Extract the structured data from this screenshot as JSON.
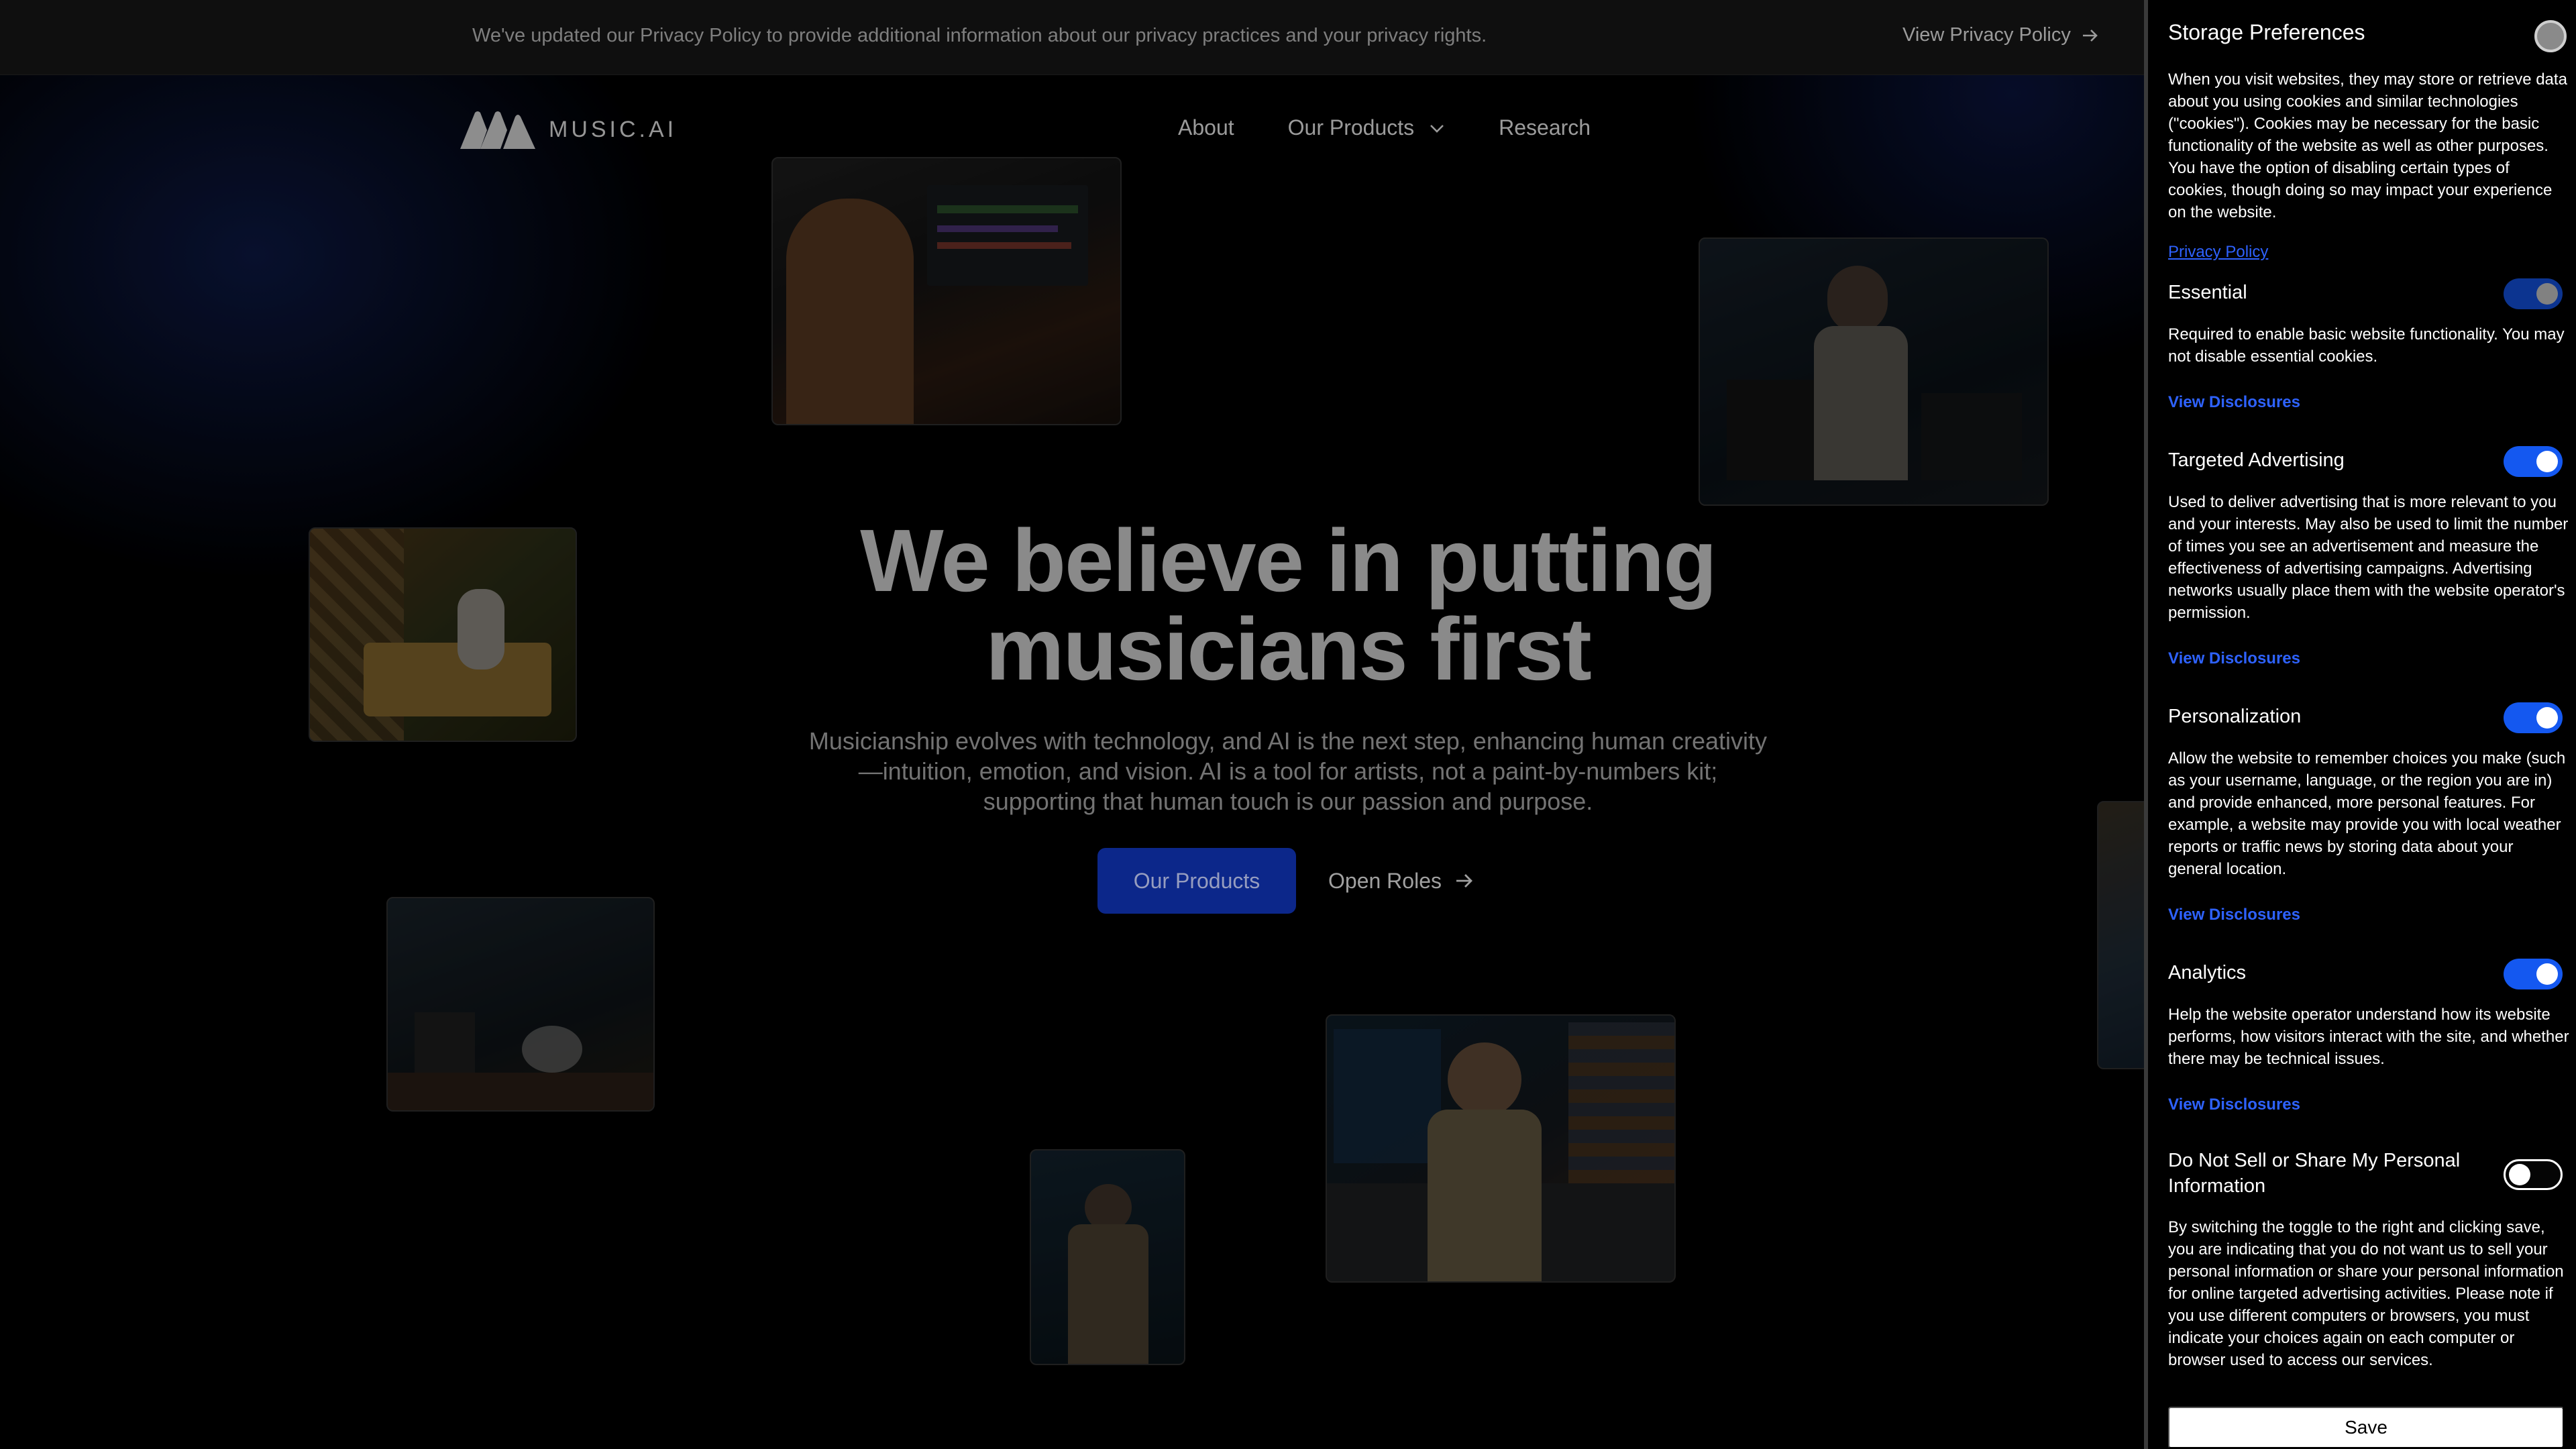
{
  "notice": {
    "text": "We've updated our Privacy Policy to provide additional information about our privacy practices and your privacy rights.",
    "link_label": "View Privacy Policy"
  },
  "brand": {
    "name": "MUSIC.AI"
  },
  "nav": {
    "items": [
      {
        "label": "About"
      },
      {
        "label": "Our Products"
      },
      {
        "label": "Research"
      }
    ]
  },
  "hero": {
    "title_line1": "We believe in putting",
    "title_line2": "musicians first",
    "subtitle": "Musicianship evolves with technology, and AI is the next step, enhancing human creativity—intuition, emotion, and vision. AI is a tool for artists, not a paint-by-numbers kit; supporting that human touch is our passion and purpose.",
    "primary_button": "Our Products",
    "secondary_button": "Open Roles"
  },
  "preferences": {
    "title": "Storage Preferences",
    "intro": "When you visit websites, they may store or retrieve data about you using cookies and similar technologies (\"cookies\"). Cookies may be necessary for the basic functionality of the website as well as other purposes. You have the option of disabling certain types of cookies, though doing so may impact your experience on the website.",
    "privacy_link": "Privacy Policy",
    "disclosures_label": "View Disclosures",
    "categories": [
      {
        "name": "Essential",
        "enabled": true,
        "locked": true,
        "description": "Required to enable basic website functionality. You may not disable essential cookies."
      },
      {
        "name": "Targeted Advertising",
        "enabled": true,
        "locked": false,
        "description": "Used to deliver advertising that is more relevant to you and your interests. May also be used to limit the number of times you see an advertisement and measure the effectiveness of advertising campaigns. Advertising networks usually place them with the website operator's permission."
      },
      {
        "name": "Personalization",
        "enabled": true,
        "locked": false,
        "description": "Allow the website to remember choices you make (such as your username, language, or the region you are in) and provide enhanced, more personal features. For example, a website may provide you with local weather reports or traffic news by storing data about your general location."
      },
      {
        "name": "Analytics",
        "enabled": true,
        "locked": false,
        "description": "Help the website operator understand how its website performs, how visitors interact with the site, and whether there may be technical issues."
      }
    ],
    "do_not_sell": {
      "label": "Do Not Sell or Share My Personal Information",
      "enabled": false,
      "description": "By switching the toggle to the right and clicking save, you are indicating that you do not want us to sell your personal information or share your personal information for online targeted advertising activities. Please note if you use different computers or browsers, you must indicate your choices again on each computer or browser used to access our services."
    },
    "save_label": "Save"
  },
  "colors": {
    "accent_blue": "#1458f0",
    "link_blue": "#2e62ff",
    "button_blue": "#1134b8"
  }
}
